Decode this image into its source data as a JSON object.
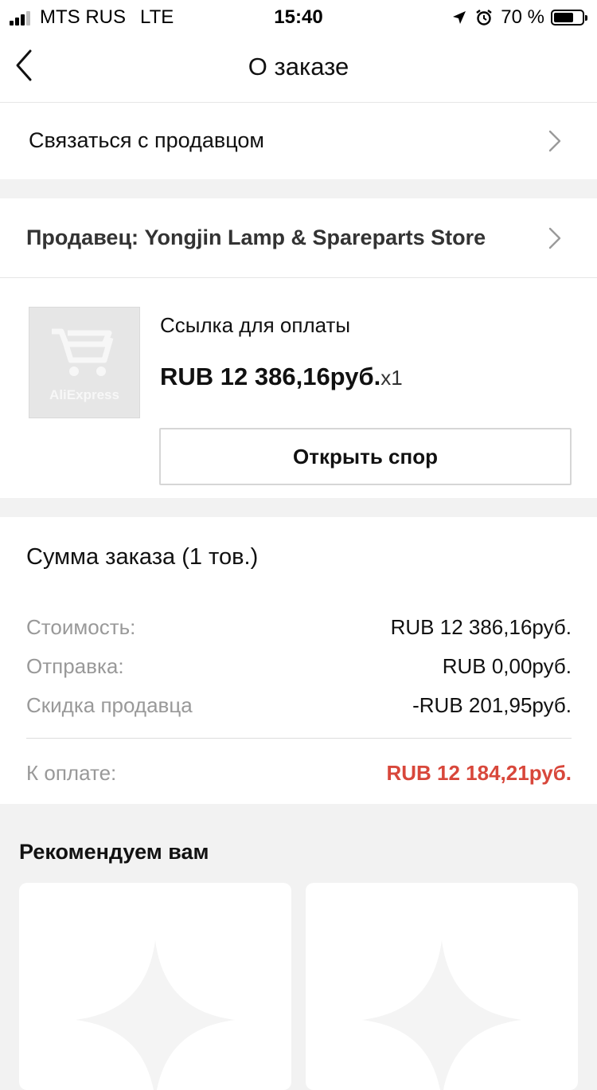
{
  "status_bar": {
    "carrier": "MTS RUS",
    "network": "LTE",
    "time": "15:40",
    "battery": "70 %",
    "battery_level": 0.7,
    "icons": [
      "signal-icon",
      "location-arrow-icon",
      "alarm-icon",
      "battery-icon"
    ]
  },
  "nav": {
    "title": "О заказе",
    "back_icon": "chevron-left-icon"
  },
  "contact": {
    "label": "Связаться с продавцом",
    "icon": "chevron-right-icon"
  },
  "seller": {
    "label": "Продавец: Yongjin Lamp & Spareparts Store",
    "icon": "chevron-right-icon"
  },
  "product": {
    "image_brand": "AliExpress",
    "image_icon": "shopping-cart-icon",
    "title": "Ссылка для оплаты",
    "price": "RUB 12 386,16руб.",
    "quantity": "x1",
    "dispute_button": "Открыть спор"
  },
  "summary": {
    "title": "Сумма заказа (1 тов.)",
    "lines": [
      {
        "label": "Стоимость:",
        "value": "RUB 12 386,16руб."
      },
      {
        "label": "Отправка:",
        "value": "RUB 0,00руб."
      },
      {
        "label": "Скидка продавца",
        "value": "-RUB 201,95руб."
      }
    ],
    "total": {
      "label": "К оплате:",
      "value": "RUB 12 184,21руб."
    }
  },
  "recommend": {
    "title": "Рекомендуем вам",
    "placeholder_icon": "sparkle-placeholder-icon"
  },
  "colors": {
    "accent_total": "#d8473b",
    "background": "#f2f2f2",
    "muted_text": "#999999"
  }
}
